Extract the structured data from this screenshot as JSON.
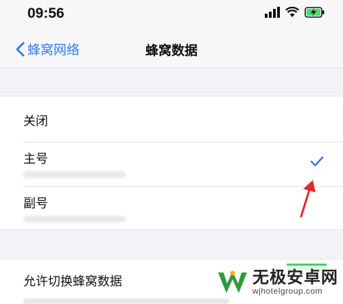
{
  "status_bar": {
    "time": "09:56",
    "icons": [
      "signal-icon",
      "wifi-icon",
      "battery-charging-icon"
    ]
  },
  "nav": {
    "back_label": "蜂窝网络",
    "title": "蜂窝数据"
  },
  "options": [
    {
      "label": "关闭",
      "selected": false
    },
    {
      "label": "主号",
      "selected": true
    },
    {
      "label": "副号",
      "selected": false
    }
  ],
  "switch_row": {
    "label": "允许切换蜂窝数据",
    "enabled": true
  },
  "watermark": {
    "main": "无极安卓网",
    "sub": "wjhotelgroup.com"
  },
  "colors": {
    "accent": "#2f7bf2",
    "annotation": "#e02a2a",
    "toggle_on": "#34c759",
    "background": "#f2f2f7"
  }
}
